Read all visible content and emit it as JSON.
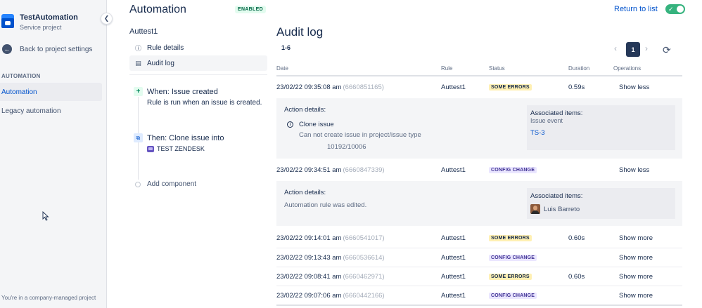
{
  "sidebar": {
    "project_name": "TestAutomation",
    "project_type": "Service project",
    "back_label": "Back to project settings",
    "section_title": "AUTOMATION",
    "items": [
      {
        "label": "Automation",
        "active": true
      },
      {
        "label": "Legacy automation",
        "active": false
      }
    ],
    "footer": "You're in a company-managed project"
  },
  "rule": {
    "page_title": "Automation",
    "status_badge": "ENABLED",
    "name": "Auttest1",
    "menu": [
      {
        "label": "Rule details",
        "icon": "info-icon"
      },
      {
        "label": "Audit log",
        "icon": "document-icon"
      }
    ],
    "trigger": {
      "title": "When: Issue created",
      "description": "Rule is run when an issue is created."
    },
    "action": {
      "title": "Then: Clone issue into",
      "target": "TEST ZENDESK"
    },
    "add_component": "Add component"
  },
  "header": {
    "return_label": "Return to list",
    "toggle_on": true
  },
  "audit": {
    "title": "Audit log",
    "range": "1-6",
    "current_page": "1",
    "columns": {
      "date": "Date",
      "rule": "Rule",
      "status": "Status",
      "duration": "Duration",
      "operations": "Operations"
    },
    "rows": [
      {
        "date": "23/02/22 09:35:08 am",
        "id": "(6660851165)",
        "rule": "Auttest1",
        "status": "SOME ERRORS",
        "duration": "0.59s",
        "op": "Show less"
      },
      {
        "date": "23/02/22 09:34:51 am",
        "id": "(6660847339)",
        "rule": "Auttest1",
        "status": "CONFIG CHANGE",
        "duration": "",
        "op": "Show less"
      },
      {
        "date": "23/02/22 09:14:01 am",
        "id": "(6660541017)",
        "rule": "Auttest1",
        "status": "SOME ERRORS",
        "duration": "0.60s",
        "op": "Show more"
      },
      {
        "date": "23/02/22 09:13:43 am",
        "id": "(6660536614)",
        "rule": "Auttest1",
        "status": "CONFIG CHANGE",
        "duration": "",
        "op": "Show more"
      },
      {
        "date": "23/02/22 09:08:41 am",
        "id": "(6660462971)",
        "rule": "Auttest1",
        "status": "SOME ERRORS",
        "duration": "0.60s",
        "op": "Show more"
      },
      {
        "date": "23/02/22 09:07:06 am",
        "id": "(6660442166)",
        "rule": "Auttest1",
        "status": "CONFIG CHANGE",
        "duration": "",
        "op": "Show more"
      }
    ],
    "details": [
      {
        "heading": "Action details:",
        "action_name": "Clone issue",
        "message": "Can not create issue in project/issue type",
        "code": "10192/10006",
        "assoc_title": "Associated items:",
        "assoc_sub": "Issue event",
        "assoc_link": "TS-3"
      },
      {
        "heading": "Action details:",
        "message": "Automation rule was edited.",
        "assoc_title": "Associated items:",
        "assoc_person": "Luis Barreto"
      }
    ]
  },
  "colors": {
    "accent": "#0052cc",
    "toggle": "#36b37e",
    "error_lozenge": "#fff0b3",
    "config_lozenge": "#eae6ff"
  }
}
